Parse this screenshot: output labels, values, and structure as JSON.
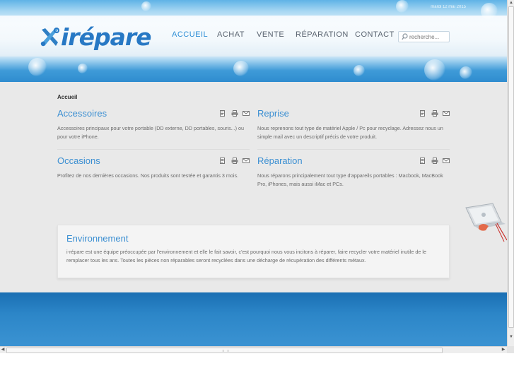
{
  "header": {
    "date": "mardi 12 mai 2015",
    "logo_text": "irépare"
  },
  "nav": {
    "items": [
      {
        "label": "ACCUEIL",
        "active": true
      },
      {
        "label": "ACHAT",
        "active": false
      },
      {
        "label": "VENTE",
        "active": false
      },
      {
        "label": "RÉPARATION",
        "active": false
      },
      {
        "label": "CONTACT",
        "active": false
      }
    ]
  },
  "search": {
    "placeholder": "recherche..."
  },
  "breadcrumb": "Accueil",
  "blocks": [
    {
      "title": "Accessoires",
      "text": "Accessoires principaux pour votre portable (DD externe, DD portables, souris...) ou pour votre iPhone."
    },
    {
      "title": "Reprise",
      "text": "Nous reprenons tout type de matériel Apple / Pc pour recyclage. Adressez nous un simple mail avec un descriptif précis de votre produit."
    },
    {
      "title": "Occasions",
      "text": "Profitez de nos dernières occasions. Nos produits sont testée et garantis 3 mois."
    },
    {
      "title": "Réparation",
      "text": "Nous réparons principalement tout type d'appareils portables : Macbook, MacBook Pro, iPhones, mais aussi iMac et PCs."
    }
  ],
  "tools": {
    "icons": [
      "pdf-icon",
      "print-icon",
      "email-icon"
    ]
  },
  "environment": {
    "title": "Environnement",
    "text": "i-répare est une équipe préoccupée par l'environnement et elle le fait savoir, c'est pourquoi nous vous incitons à réparer, faire recycler votre matériel inutile de le remplacer tous les ans. Toutes les pièces non réparables seront recyclées dans une décharge de récupération des différents métaux."
  },
  "colors": {
    "accent": "#3b8fd2",
    "logo": "#2778c4",
    "footer": "#2c86c8"
  }
}
